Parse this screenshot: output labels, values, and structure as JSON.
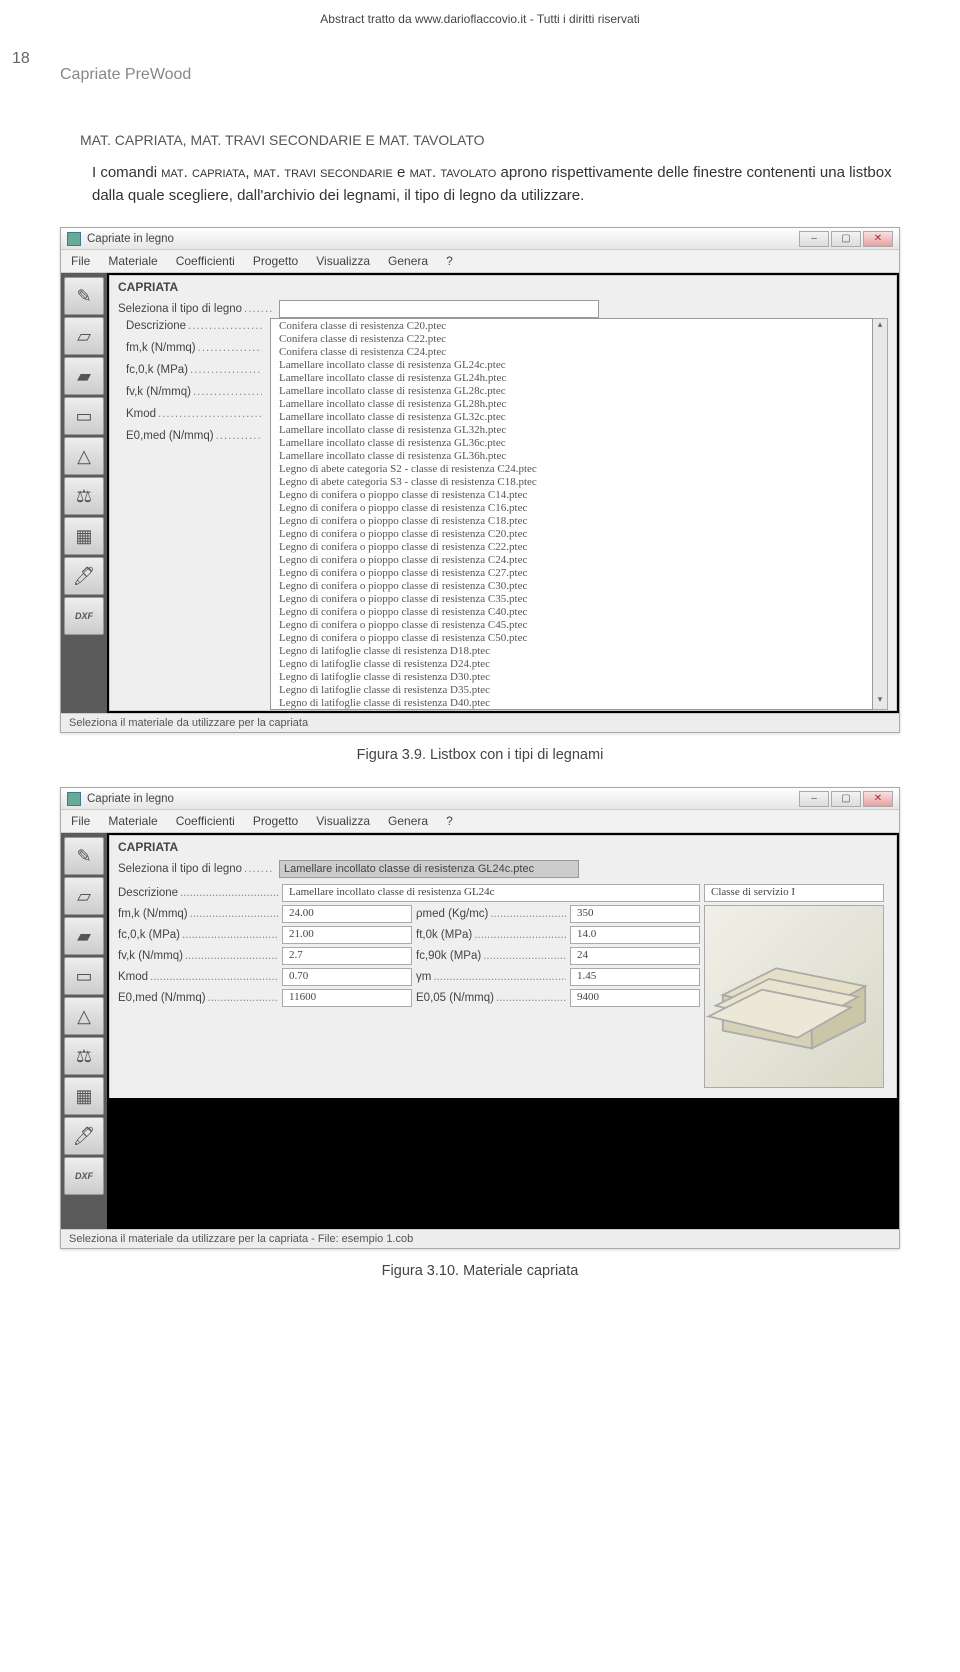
{
  "header_text": "Abstract tratto da www.darioflaccovio.it - Tutti i diritti riservati",
  "page_number": "18",
  "book_title": "Capriate PreWood",
  "section_heading": "MAT. CAPRIATA, MAT. TRAVI SECONDARIE E MAT. TAVOLATO",
  "body_text_parts": {
    "p1": "I comandi ",
    "sc1": "mat. capriata",
    "p2": ", ",
    "sc2": "mat. travi secondarie",
    "p3": " e ",
    "sc3": "mat. tavolato",
    "p4": " aprono rispettivamente delle finestre contenenti una listbox dalla quale scegliere, dall'archivio dei legnami, il tipo di legno da utilizzare."
  },
  "app_title": "Capriate in legno",
  "menu": [
    "File",
    "Materiale",
    "Coefficienti",
    "Progetto",
    "Visualizza",
    "Genera",
    "?"
  ],
  "panel_title": "CAPRIATA",
  "labels": {
    "seleziona": "Seleziona il tipo di legno",
    "descrizione": "Descrizione",
    "fmk": "fm,k (N/mmq)",
    "fc0k": "fc,0,k (MPa)",
    "fvk": "fv,k (N/mmq)",
    "kmod": "Kmod",
    "e0med": "E0,med (N/mmq)"
  },
  "listbox_items": [
    "Conifera classe di resistenza C20.ptec",
    "Conifera classe di resistenza C22.ptec",
    "Conifera classe di resistenza C24.ptec",
    "Lamellare incollato classe di resistenza GL24c.ptec",
    "Lamellare incollato classe di resistenza GL24h.ptec",
    "Lamellare incollato classe di resistenza GL28c.ptec",
    "Lamellare incollato classe di resistenza GL28h.ptec",
    "Lamellare incollato classe di resistenza GL32c.ptec",
    "Lamellare incollato classe di resistenza GL32h.ptec",
    "Lamellare incollato classe di resistenza GL36c.ptec",
    "Lamellare incollato classe di resistenza GL36h.ptec",
    "Legno di abete categoria S2 - classe di resistenza C24.ptec",
    "Legno di abete categoria S3 - classe di resistenza C18.ptec",
    "Legno di conifera o pioppo classe di resistenza C14.ptec",
    "Legno di conifera o pioppo classe di resistenza C16.ptec",
    "Legno di conifera o pioppo classe di resistenza C18.ptec",
    "Legno di conifera o pioppo classe di resistenza C20.ptec",
    "Legno di conifera o pioppo classe di resistenza C22.ptec",
    "Legno di conifera o pioppo classe di resistenza C24.ptec",
    "Legno di conifera o pioppo classe di resistenza C27.ptec",
    "Legno di conifera o pioppo classe di resistenza C30.ptec",
    "Legno di conifera o pioppo classe di resistenza C35.ptec",
    "Legno di conifera o pioppo classe di resistenza C40.ptec",
    "Legno di conifera o pioppo classe di resistenza C45.ptec",
    "Legno di conifera o pioppo classe di resistenza C50.ptec",
    "Legno di latifoglie classe di resistenza D18.ptec",
    "Legno di latifoglie classe di resistenza D24.ptec",
    "Legno di latifoglie classe di resistenza D30.ptec",
    "Legno di latifoglie classe di resistenza D35.ptec",
    "Legno di latifoglie classe di resistenza D40.ptec"
  ],
  "statusbar1": "Seleziona il materiale da utilizzare per la capriata",
  "caption1": "Figura 3.9. Listbox con i tipi di legnami",
  "selected_type": "Lamellare incollato classe di resistenza GL24c.ptec",
  "desc_value": "Lamellare incollato classe di resistenza GL24c",
  "class_service": "Classe di servizio I",
  "props": {
    "fmk_v": "24.00",
    "pmed_l": "ρmed (Kg/mc)",
    "pmed_v": "350",
    "fc0k_v": "21.00",
    "ft0k_l": "ft,0k (MPa)",
    "ft0k_v": "14.0",
    "fvk_v": "2.7",
    "fc90k_l": "fc,90k (MPa)",
    "fc90k_v": "24",
    "kmod_v": "0.70",
    "ym_l": "γm",
    "ym_v": "1.45",
    "e0med_v": "11600",
    "e005_l": "E0,05 (N/mmq)",
    "e005_v": "9400"
  },
  "statusbar2": "Seleziona il materiale da utilizzare per la capriata  -  File: esempio 1.cob",
  "caption2": "Figura 3.10. Materiale capriata",
  "sideicons": [
    "✎",
    "▱",
    "▰",
    "▭",
    "△",
    "⚖",
    "▦",
    "🖊",
    "DXF"
  ],
  "sideicons2": [
    "✎",
    "▱",
    "▰",
    "▭",
    "△",
    "⚖",
    "▦",
    "🖊",
    "DXF"
  ]
}
